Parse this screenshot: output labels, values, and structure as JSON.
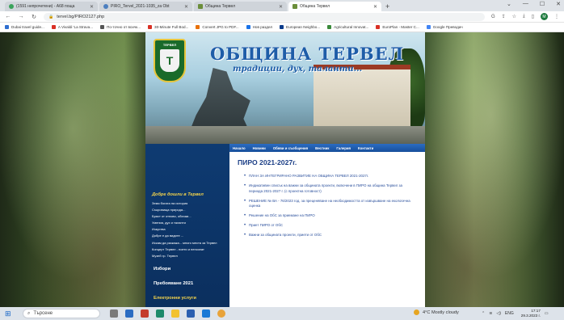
{
  "browser": {
    "tabs": [
      {
        "title": "(1591 непрочетени) - A68 поща",
        "active": false
      },
      {
        "title": "PIRO_Tervel_2021-1035_za Obt",
        "active": false
      },
      {
        "title": "Община Тервел",
        "active": false
      },
      {
        "title": "Община Тервел",
        "active": true
      }
    ],
    "new_tab": "+",
    "url": "tervel.bg/PIRO2127.php",
    "avatar_letter": "M",
    "bookmarks": [
      {
        "label": "Dubai travel guide...",
        "color": "#2f6fd0"
      },
      {
        "label": "A Vivaldi 'La Strava...",
        "color": "#d93025"
      },
      {
        "label": "По-точно от всичк...",
        "color": "#555555"
      },
      {
        "label": "30-Minute Full Bod...",
        "color": "#d93025"
      },
      {
        "label": "Convert JPG to PDF...",
        "color": "#e8710a"
      },
      {
        "label": "Нов раздел",
        "color": "#1a73e8"
      },
      {
        "label": "European Neighbo...",
        "color": "#0b3c8c"
      },
      {
        "label": "Agricultural Innovat...",
        "color": "#3a8a3a"
      },
      {
        "label": "EuroPlan - Master C...",
        "color": "#d93025"
      },
      {
        "label": "Google Преводач",
        "color": "#4285f4"
      }
    ]
  },
  "site": {
    "title": "ОБЩИНА ТЕРВЕЛ",
    "slogan": "традиции, дух, таланти...",
    "crest_label": "ТЕРВЕЛ",
    "crest_letter": "T",
    "nav": [
      "Начало",
      "Новини",
      "Обяви и съобщения",
      "Вестник",
      "Галерия",
      "Контакти"
    ],
    "sidebar": {
      "heading": "Добре дошли в Тервел",
      "links": [
        "Земя богата на история",
        "Съкровища природа...",
        "Бряст от отново, обичаи...",
        "Умения, дух и таланти",
        "Изкуства",
        "Добре е да видите ...",
        "Искам да разкажа... много места за Тервел",
        "Концерт Тервел - поети и непознат",
        "Музей гр. Тервел"
      ],
      "items": [
        "Избори",
        "Пребояване 2021"
      ],
      "eservices": "Електронни услуги"
    },
    "content": {
      "heading": "ПИРО 2021-2027г.",
      "items": [
        "ПЛАН ЗА ИНТЕГРИРАНО РАЗВИТИЕ НА ОБЩИНА ТЕРВЕЛ 2021-2027г.",
        "Индикативен списък на важни за общината проекти, включени в ПИРО на община Тервел за периода 2021-2027 г. (с проектна готовност)",
        "РЕШЕНИЕ № ВА - 76/2023 год. за преценяване на необходимостта от извършване на екологична оценка",
        "Решение на ОбС за приемане на ПИРО",
        "Приет ПИРО от ОбС",
        "Важни за общината проекти, приети от ОбС"
      ]
    }
  },
  "taskbar": {
    "search_placeholder": "Търсене",
    "weather": "4°C Mostly cloudy",
    "lang": "ENG",
    "time": "17:17",
    "date": "29.3.2023 г."
  }
}
